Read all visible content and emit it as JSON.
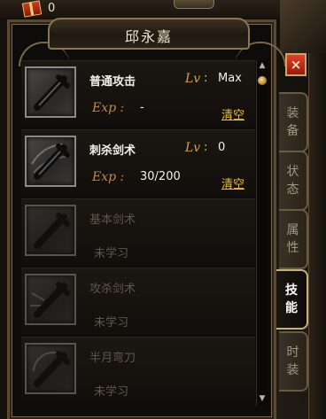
{
  "top": {
    "count": "0"
  },
  "panel": {
    "title": "邱永嘉"
  },
  "labels": {
    "lv": "Lv",
    "colon": ":",
    "exp": "Exp :"
  },
  "skills": [
    {
      "name": "普通攻击",
      "lv": "Max",
      "exp": "-",
      "clear": "清空",
      "learned": true
    },
    {
      "name": "刺杀剑术",
      "lv": "0",
      "exp": "30/200",
      "clear": "清空",
      "learned": true
    },
    {
      "name": "基本剑术",
      "status": "未学习",
      "learned": false
    },
    {
      "name": "攻杀剑术",
      "status": "未学习",
      "learned": false
    },
    {
      "name": "半月弯刀",
      "status": "未学习",
      "learned": false
    }
  ],
  "tabs": [
    {
      "label": [
        "装",
        "备"
      ],
      "active": false
    },
    {
      "label": [
        "状",
        "态"
      ],
      "active": false
    },
    {
      "label": [
        "属",
        "性"
      ],
      "active": false
    },
    {
      "label": [
        "技",
        "能"
      ],
      "active": true
    },
    {
      "label": [
        "时",
        "装"
      ],
      "active": false
    }
  ],
  "close": "×",
  "colors": {
    "accent": "#f0c020",
    "exp_label": "#c88a3a",
    "lv_label": "#d8a040",
    "close": "#c8281a"
  }
}
